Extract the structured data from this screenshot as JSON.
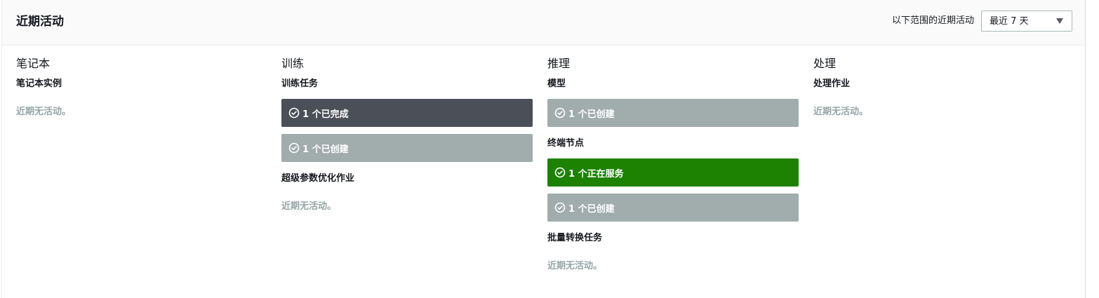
{
  "header": {
    "title": "近期活动",
    "range_label": "以下范围的近期活动",
    "range_value": "最近 7 天"
  },
  "columns": [
    {
      "title": "笔记本",
      "sections": [
        {
          "label": "笔记本实例",
          "empty": "近期无活动。"
        }
      ]
    },
    {
      "title": "训练",
      "sections": [
        {
          "label": "训练任务",
          "items": [
            {
              "text": "1 个已完成",
              "status": "dark"
            },
            {
              "text": "1 个已创建",
              "status": "grey"
            }
          ]
        },
        {
          "label": "超级参数优化作业",
          "empty": "近期无活动。"
        }
      ]
    },
    {
      "title": "推理",
      "sections": [
        {
          "label": "模型",
          "items": [
            {
              "text": "1 个已创建",
              "status": "grey"
            }
          ]
        },
        {
          "label": "终端节点",
          "items": [
            {
              "text": "1 个正在服务",
              "status": "green"
            },
            {
              "text": "1 个已创建",
              "status": "grey"
            }
          ]
        },
        {
          "label": "批量转换任务",
          "empty": "近期无活动。"
        }
      ]
    },
    {
      "title": "处理",
      "sections": [
        {
          "label": "处理作业",
          "empty": "近期无活动。"
        }
      ]
    }
  ],
  "colors": {
    "dark": "#4b4f57",
    "grey": "#a1acac",
    "green": "#1d8102",
    "muted_text": "#95a5a6"
  },
  "icons": {
    "status": "check-circle-icon",
    "dropdown": "caret-down-icon"
  }
}
